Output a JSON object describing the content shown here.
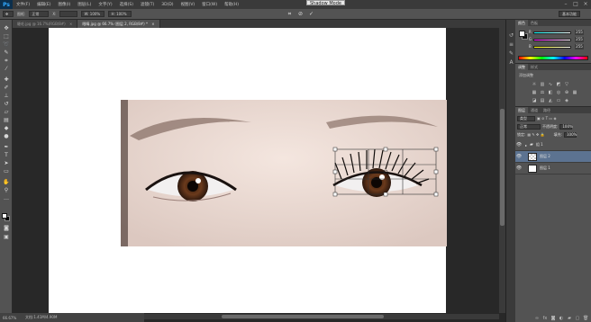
{
  "app": {
    "logo": "Ps"
  },
  "menu": [
    "文件(F)",
    "编辑(E)",
    "图像(I)",
    "图层(L)",
    "文字(Y)",
    "选择(S)",
    "滤镜(T)",
    "3D(D)",
    "视图(V)",
    "窗口(W)",
    "帮助(H)"
  ],
  "window_controls": {
    "minimize": "–",
    "maximize": "□",
    "close": "×"
  },
  "options": {
    "field1": "图框:",
    "field2": "正常",
    "field3": "X:",
    "field4": "W: 100%",
    "field5": "H: 100%",
    "shadow_mode": "Shadow Mode",
    "workspace": "基本功能"
  },
  "tabs": [
    {
      "label": "睫毛.jpg @ 16.7%(RGB/8#)",
      "close": "×",
      "active": false
    },
    {
      "label": "眼睛.jpg @ 66.7% (图层 2, RGB/8#) *",
      "close": "×",
      "active": true
    }
  ],
  "status": {
    "zoom": "66.67%",
    "doc": "文档:1.41M/4.90M"
  },
  "color_panel": {
    "tabs": [
      "颜色",
      "色板"
    ],
    "sliders": [
      {
        "letter": "R",
        "value": "255",
        "gradient": "linear-gradient(to right,#00ffff,#ffffff)"
      },
      {
        "letter": "G",
        "value": "255",
        "gradient": "linear-gradient(to right,#ff00ff,#ffffff)"
      },
      {
        "letter": "B",
        "value": "255",
        "gradient": "linear-gradient(to right,#ffff00,#ffffff)"
      }
    ]
  },
  "adjustments": {
    "tabs": [
      "调整",
      "样式"
    ],
    "heading": "添加调整"
  },
  "layers": {
    "tabs": [
      "图层",
      "通道",
      "路径"
    ],
    "kind": "类型",
    "blend": "正常",
    "opacity_label": "不透明度:",
    "opacity": "100%",
    "lock_label": "锁定:",
    "fill_label": "填充:",
    "fill": "100%",
    "items": [
      {
        "name": "组 1",
        "type": "group",
        "visible": true,
        "selected": false
      },
      {
        "name": "图层 2",
        "type": "layer",
        "visible": true,
        "selected": true
      },
      {
        "name": "图层 1",
        "type": "layer",
        "visible": true,
        "selected": false
      }
    ]
  }
}
